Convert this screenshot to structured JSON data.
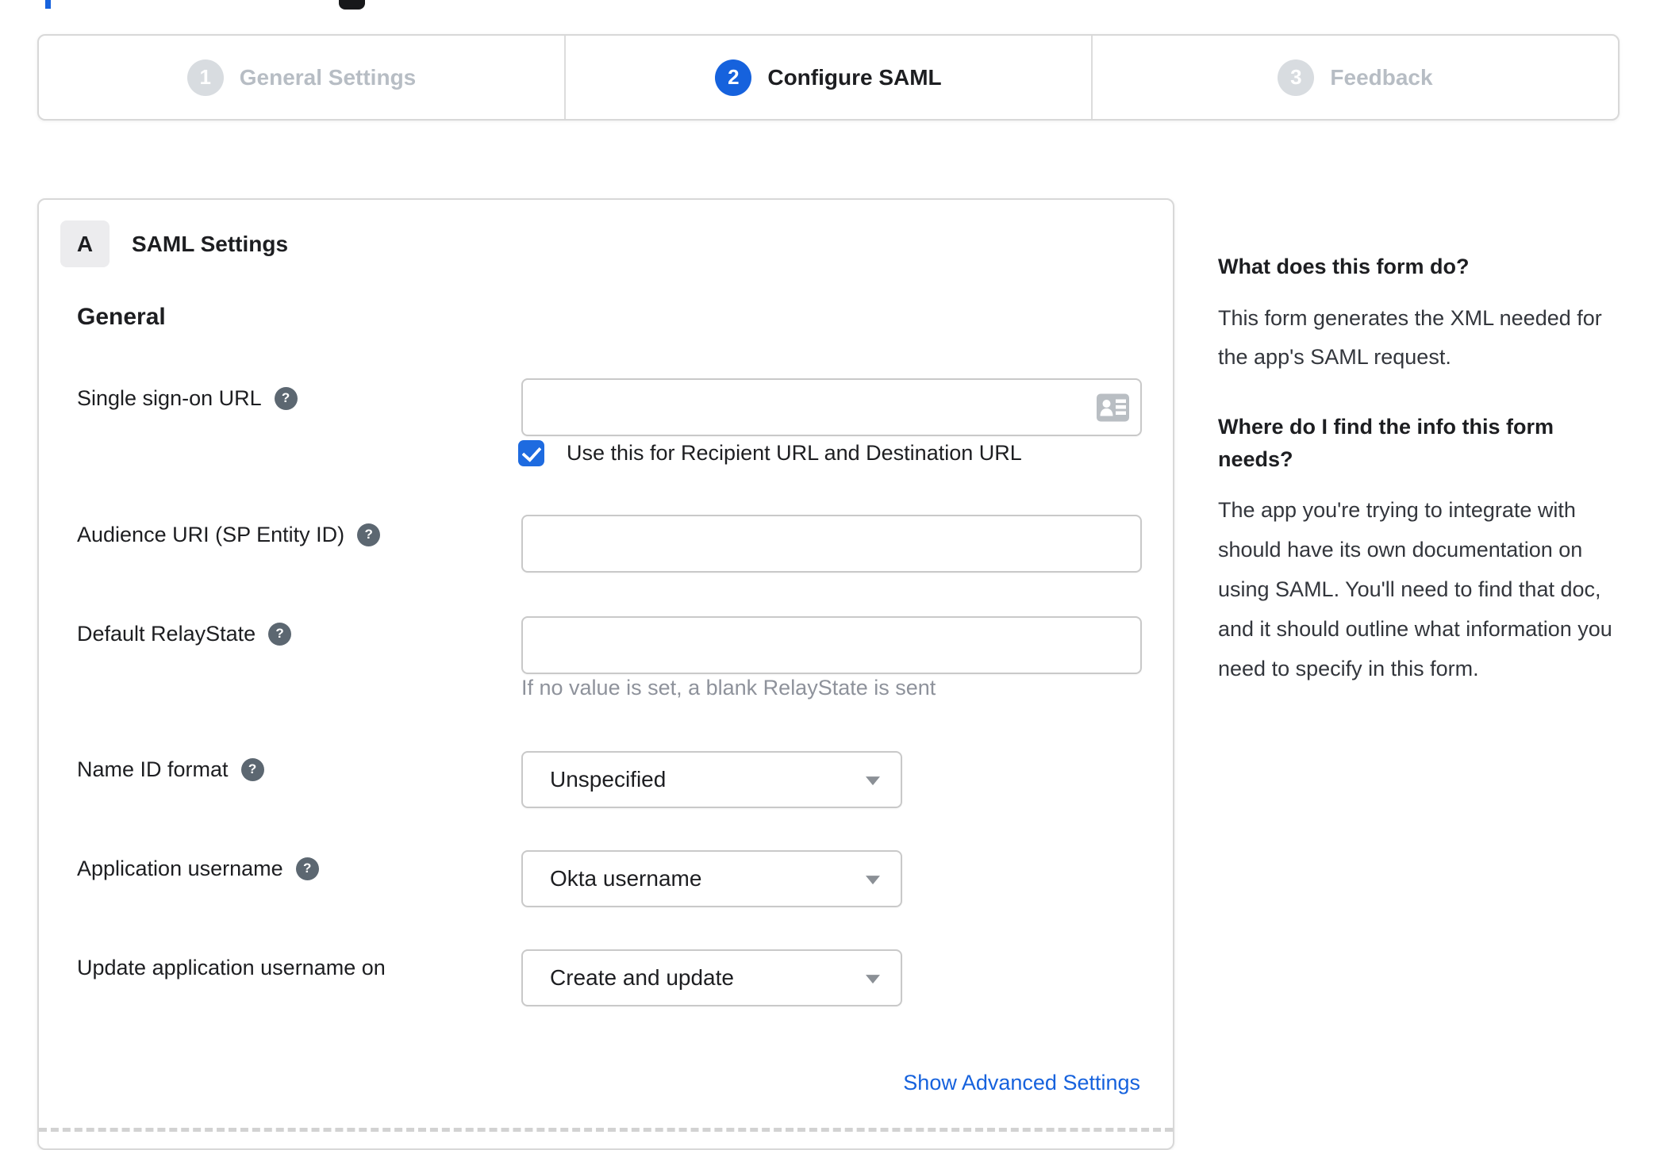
{
  "colors": {
    "accent": "#1662dd",
    "checkbox_blue": "#1e6be0",
    "inactive_step_gray": "#b7bdc4",
    "border_gray": "#d8d8d8"
  },
  "icons": {
    "help_glyph": "?",
    "sso_input_icon": "contact-card",
    "select_arrow": "triangle-down"
  },
  "stepper": {
    "steps": [
      {
        "number": "1",
        "label": "General Settings",
        "active": false
      },
      {
        "number": "2",
        "label": "Configure SAML",
        "active": true
      },
      {
        "number": "3",
        "label": "Feedback",
        "active": false
      }
    ]
  },
  "form": {
    "section_badge": "A",
    "section_title": "SAML Settings",
    "group_title": "General",
    "fields": {
      "sso": {
        "label": "Single sign-on URL",
        "value": "",
        "checkbox_label": "Use this for Recipient URL and Destination URL",
        "checked": true
      },
      "audience": {
        "label": "Audience URI (SP Entity ID)",
        "value": ""
      },
      "relay": {
        "label": "Default RelayState",
        "value": "",
        "hint": "If no value is set, a blank RelayState is sent"
      },
      "nameid": {
        "label": "Name ID format",
        "value": "Unspecified"
      },
      "appuser": {
        "label": "Application username",
        "value": "Okta username"
      },
      "update": {
        "label": "Update application username on",
        "value": "Create and update"
      }
    },
    "advanced_link": "Show Advanced Settings"
  },
  "help_panel": {
    "q1": "What does this form do?",
    "a1": "This form generates the XML needed for the app's SAML request.",
    "q2": "Where do I find the info this form needs?",
    "a2": "The app you're trying to integrate with should have its own documentation on using SAML. You'll need to find that doc, and it should outline what information you need to specify in this form."
  }
}
